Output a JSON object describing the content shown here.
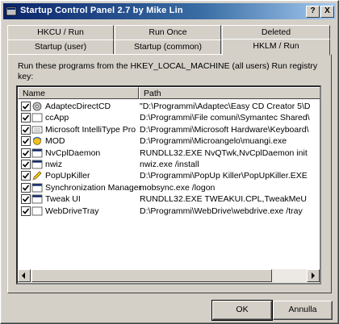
{
  "window": {
    "title": "Startup Control Panel 2.7 by Mike Lin",
    "help_label": "?",
    "close_label": "X"
  },
  "tabs": {
    "row1": [
      {
        "label": "HKCU / Run"
      },
      {
        "label": "Run Once"
      },
      {
        "label": "Deleted"
      }
    ],
    "row2": [
      {
        "label": "Startup (user)"
      },
      {
        "label": "Startup (common)"
      },
      {
        "label": "HKLM / Run",
        "active": true
      }
    ]
  },
  "panel": {
    "description": "Run these programs from the HKEY_LOCAL_MACHINE (all users) Run registry key:"
  },
  "list": {
    "columns": [
      "Name",
      "Path"
    ],
    "rows": [
      {
        "name": "AdaptecDirectCD",
        "path": "\"D:\\Programmi\\Adaptec\\Easy CD Creator 5\\D",
        "icon": "cd-icon",
        "checked": true
      },
      {
        "name": "ccApp",
        "path": "D:\\Programmi\\File comuni\\Symantec Shared\\",
        "icon": "blank-app-icon",
        "checked": true
      },
      {
        "name": "Microsoft IntelliType Pro",
        "path": "D:\\Programmi\\Microsoft Hardware\\Keyboard\\",
        "icon": "keyboard-icon",
        "checked": true
      },
      {
        "name": "MOD",
        "path": "D:\\Programmi\\Microangelo\\muangi.exe",
        "icon": "angel-icon",
        "checked": true
      },
      {
        "name": "NvCplDaemon",
        "path": "RUNDLL32.EXE NvQTwk,NvCplDaemon init",
        "icon": "window-icon",
        "checked": true
      },
      {
        "name": "nwiz",
        "path": "nwiz.exe /install",
        "icon": "window-icon",
        "checked": true
      },
      {
        "name": "PopUpKiller",
        "path": "D:\\Programmi\\PopUp Killer\\PopUpKiller.EXE",
        "icon": "pencil-icon",
        "checked": true
      },
      {
        "name": "Synchronization Manager",
        "path": "mobsync.exe /logon",
        "icon": "window-icon",
        "checked": true
      },
      {
        "name": "Tweak UI",
        "path": "RUNDLL32.EXE TWEAKUI.CPL,TweakMeU",
        "icon": "window-icon",
        "checked": true
      },
      {
        "name": "WebDriveTray",
        "path": "D:\\Programmi\\WebDrive\\webdrive.exe /tray",
        "icon": "blank-app-icon",
        "checked": true
      }
    ]
  },
  "buttons": {
    "ok_label": "OK",
    "cancel_label": "Annulla"
  },
  "colors": {
    "titlebar_start": "#0a246a",
    "titlebar_end": "#a6caf0",
    "face": "#d4d0c8"
  }
}
